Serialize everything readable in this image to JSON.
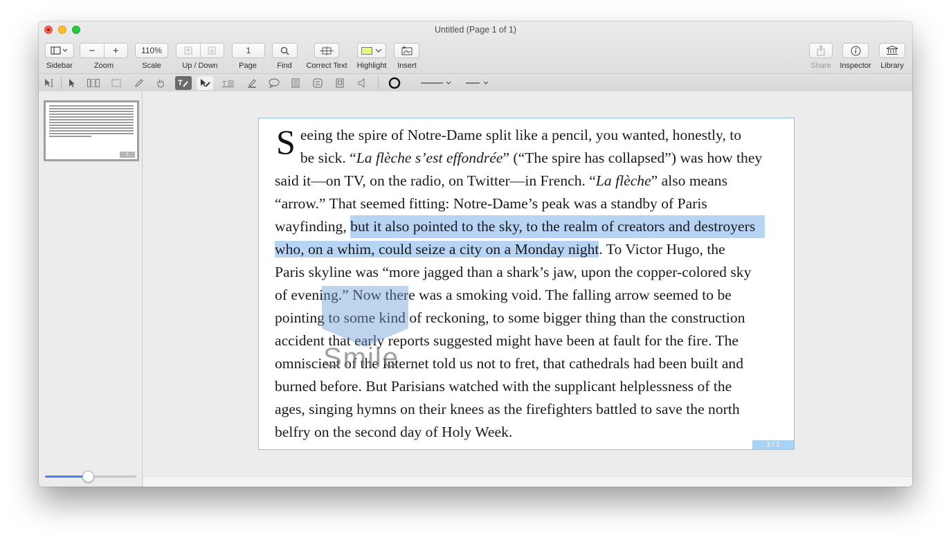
{
  "window": {
    "title": "Untitled (Page 1 of 1)"
  },
  "toolbar": {
    "zoom_value": "110%",
    "page_value": "1",
    "labels": {
      "sidebar": "Sidebar",
      "zoom": "Zoom",
      "scale": "Scale",
      "updown": "Up / Down",
      "page": "Page",
      "find": "Find",
      "correct_text": "Correct Text",
      "highlight": "Highlight",
      "insert": "Insert",
      "share": "Share",
      "inspector": "Inspector",
      "library": "Library"
    },
    "zoom_out_glyph": "−",
    "zoom_in_glyph": "+",
    "highlight_color": "#e9f97e"
  },
  "sidebar": {
    "thumbnail_page_number": "1",
    "zoom_slider_level": 0.47
  },
  "document": {
    "dropcap": "S",
    "line1": "eeing the spire of Notre-Dame split like a pencil, you wanted, honestly, to",
    "line2_a": "be sick. “",
    "line2_b": "La flèche s’est effondrée",
    "line2_c": "” (“The spire has collapsed”) was how they",
    "line3_a": "said it—on TV, on the radio, on Twitter—in French. “",
    "line3_b": "La flèche",
    "line3_c": "” also means",
    "line4": "“arrow.” That seemed fitting: Notre-Dame’s peak was a standby of Paris",
    "line5_a": "wayfinding, ",
    "line5_b": "but it also pointed to the sky, to the realm of creators and destroyers",
    "line6_a": "who, on a whim, could seize a city on a Monday night",
    "line6_b": ". To Victor Hugo, the",
    "line7": "Paris skyline was “more jagged than a shark’s jaw, upon the copper-colored sky",
    "line8": "of evening.” Now there was a smoking void. The falling arrow seemed to be",
    "line9": "pointing to some kind of reckoning, to some bigger thing than the construction",
    "line10": "accident that early reports suggested might have been at fault for the fire. The",
    "line11": "omniscient of the Internet told us not to fret, that cathedrals had been built and",
    "line12": "burned before. But Parisians watched with the supplicant helplessness of the",
    "line13": "ages, singing hymns on their knees as the firefighters battled to save the north",
    "line14": "belfry on the second day of Holy Week.",
    "page_badge": "1 / 1",
    "highlight_color": "#b8d4f5"
  },
  "watermark": {
    "text": "Smile"
  }
}
